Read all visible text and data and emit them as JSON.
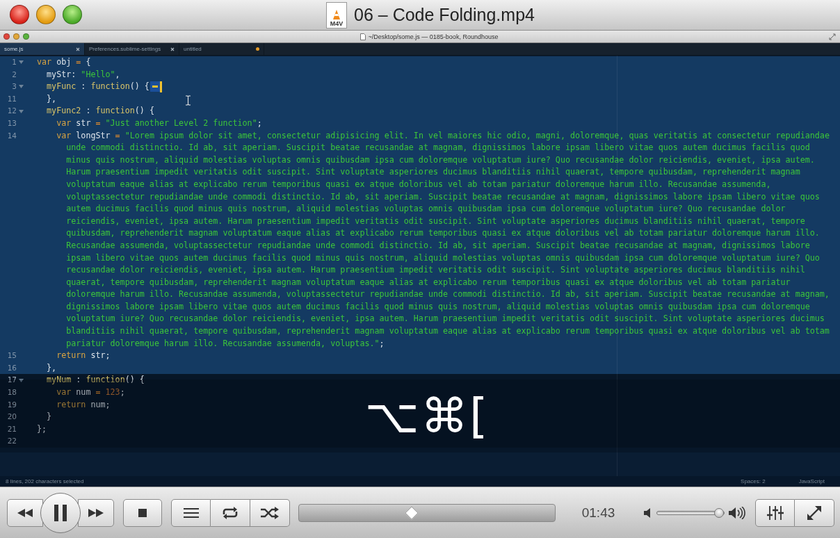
{
  "player": {
    "title": "06 – Code Folding.mp4",
    "file_badge": "M4V"
  },
  "editor": {
    "title": "~/Desktop/some.js — 0185-book, Roundhouse",
    "tabs": [
      {
        "label": "some.js",
        "selected": true,
        "modified": false
      },
      {
        "label": "Preferences.sublime-settings",
        "selected": false,
        "modified": false
      },
      {
        "label": "untitled",
        "selected": false,
        "modified": true
      }
    ],
    "lines": [
      {
        "number": "1",
        "foldable": true,
        "folded": false,
        "selected": true,
        "segments": [
          {
            "kind": "kw",
            "text": "var"
          },
          {
            "kind": "id",
            "text": " obj "
          },
          {
            "kind": "op",
            "text": "="
          },
          {
            "kind": "p",
            "text": " {"
          }
        ]
      },
      {
        "number": "2",
        "foldable": false,
        "folded": false,
        "selected": true,
        "segments": [
          {
            "kind": "id",
            "text": "  myStr: "
          },
          {
            "kind": "str",
            "text": "\"Hello\""
          },
          {
            "kind": "p",
            "text": ","
          }
        ]
      },
      {
        "number": "3",
        "foldable": true,
        "folded": true,
        "selected": true,
        "segments": [
          {
            "kind": "fn",
            "text": "  myFunc"
          },
          {
            "kind": "p",
            "text": " : "
          },
          {
            "kind": "fn",
            "text": "function"
          },
          {
            "kind": "p",
            "text": "() {"
          }
        ]
      },
      {
        "number": "11",
        "foldable": false,
        "folded": false,
        "selected": true,
        "segments": [
          {
            "kind": "p",
            "text": "  },"
          }
        ]
      },
      {
        "number": "12",
        "foldable": true,
        "folded": false,
        "selected": true,
        "segments": [
          {
            "kind": "fn",
            "text": "  myFunc2"
          },
          {
            "kind": "p",
            "text": " : "
          },
          {
            "kind": "fn",
            "text": "function"
          },
          {
            "kind": "p",
            "text": "() {"
          }
        ]
      },
      {
        "number": "13",
        "foldable": false,
        "folded": false,
        "selected": true,
        "segments": [
          {
            "kind": "kw",
            "text": "    var"
          },
          {
            "kind": "id",
            "text": " str "
          },
          {
            "kind": "op",
            "text": "="
          },
          {
            "kind": "str",
            "text": " \"Just another Level 2 function\""
          },
          {
            "kind": "p",
            "text": ";"
          }
        ]
      },
      {
        "number": "14",
        "foldable": false,
        "folded": false,
        "selected": true,
        "segments": [
          {
            "kind": "kw",
            "text": "    var"
          },
          {
            "kind": "id",
            "text": " longStr "
          },
          {
            "kind": "op",
            "text": "="
          },
          {
            "kind": "str",
            "text": " \"Lorem ipsum dolor sit amet, consectetur adipisicing elit. In vel maiores hic odio, magni, doloremque, quas veritatis at consectetur repudiandae"
          }
        ],
        "continuation": [
          [
            {
              "kind": "str",
              "text": "unde commodi distinctio. Id ab, sit aperiam. Suscipit beatae recusandae at magnam, dignissimos labore ipsam libero vitae quos autem ducimus facilis quod"
            }
          ],
          [
            {
              "kind": "str",
              "text": "minus quis nostrum, aliquid molestias voluptas omnis quibusdam ipsa cum doloremque voluptatum iure? Quo recusandae dolor reiciendis, eveniet, ipsa autem."
            }
          ],
          [
            {
              "kind": "str",
              "text": "Harum praesentium impedit veritatis odit suscipit. Sint voluptate asperiores ducimus blanditiis nihil quaerat, tempore quibusdam, reprehenderit magnam"
            }
          ],
          [
            {
              "kind": "str",
              "text": "voluptatum eaque alias at explicabo rerum temporibus quasi ex atque doloribus vel ab totam pariatur doloremque harum illo. Recusandae assumenda,"
            }
          ],
          [
            {
              "kind": "str",
              "text": "voluptassectetur repudiandae unde commodi distinctio. Id ab, sit aperiam. Suscipit beatae recusandae at magnam, dignissimos labore ipsam libero vitae quos"
            }
          ],
          [
            {
              "kind": "str",
              "text": "autem ducimus facilis quod minus quis nostrum, aliquid molestias voluptas omnis quibusdam ipsa cum doloremque voluptatum iure? Quo recusandae dolor"
            }
          ],
          [
            {
              "kind": "str",
              "text": "reiciendis, eveniet, ipsa autem. Harum praesentium impedit veritatis odit suscipit. Sint voluptate asperiores ducimus blanditiis nihil quaerat, tempore"
            }
          ],
          [
            {
              "kind": "str",
              "text": "quibusdam, reprehenderit magnam voluptatum eaque alias at explicabo rerum temporibus quasi ex atque doloribus vel ab totam pariatur doloremque harum illo."
            }
          ],
          [
            {
              "kind": "str",
              "text": "Recusandae assumenda, voluptassectetur repudiandae unde commodi distinctio. Id ab, sit aperiam. Suscipit beatae recusandae at magnam, dignissimos labore"
            }
          ],
          [
            {
              "kind": "str",
              "text": "ipsam libero vitae quos autem ducimus facilis quod minus quis nostrum, aliquid molestias voluptas omnis quibusdam ipsa cum doloremque voluptatum iure? Quo"
            }
          ],
          [
            {
              "kind": "str",
              "text": "recusandae dolor reiciendis, eveniet, ipsa autem. Harum praesentium impedit veritatis odit suscipit. Sint voluptate asperiores ducimus blanditiis nihil"
            }
          ],
          [
            {
              "kind": "str",
              "text": "quaerat, tempore quibusdam, reprehenderit magnam voluptatum eaque alias at explicabo rerum temporibus quasi ex atque doloribus vel ab totam pariatur"
            }
          ],
          [
            {
              "kind": "str",
              "text": "doloremque harum illo. Recusandae assumenda, voluptassectetur repudiandae unde commodi distinctio. Id ab, sit aperiam. Suscipit beatae recusandae at magnam,"
            }
          ],
          [
            {
              "kind": "str",
              "text": "dignissimos labore ipsam libero vitae quos autem ducimus facilis quod minus quis nostrum, aliquid molestias voluptas omnis quibusdam ipsa cum doloremque"
            }
          ],
          [
            {
              "kind": "str",
              "text": "voluptatum iure? Quo recusandae dolor reiciendis, eveniet, ipsa autem. Harum praesentium impedit veritatis odit suscipit. Sint voluptate asperiores ducimus"
            }
          ],
          [
            {
              "kind": "str",
              "text": "blanditiis nihil quaerat, tempore quibusdam, reprehenderit magnam voluptatum eaque alias at explicabo rerum temporibus quasi ex atque doloribus vel ab totam"
            }
          ],
          [
            {
              "kind": "str",
              "text": "pariatur doloremque harum illo. Recusandae assumenda, voluptas.\""
            },
            {
              "kind": "p",
              "text": ";"
            }
          ]
        ]
      },
      {
        "number": "15",
        "foldable": false,
        "folded": false,
        "selected": true,
        "segments": [
          {
            "kind": "kw",
            "text": "    return"
          },
          {
            "kind": "id",
            "text": " str;"
          }
        ]
      },
      {
        "number": "16",
        "foldable": false,
        "folded": false,
        "selected": true,
        "segments": [
          {
            "kind": "p",
            "text": "  },"
          }
        ]
      },
      {
        "number": "17",
        "foldable": true,
        "folded": false,
        "selected": false,
        "segments": [
          {
            "kind": "fn",
            "text": "  myNum"
          },
          {
            "kind": "p",
            "text": " : "
          },
          {
            "kind": "fn",
            "text": "function"
          },
          {
            "kind": "p",
            "text": "() {"
          }
        ]
      },
      {
        "number": "18",
        "foldable": false,
        "folded": false,
        "selected": false,
        "segments": [
          {
            "kind": "kw",
            "text": "    var"
          },
          {
            "kind": "id",
            "text": " num "
          },
          {
            "kind": "op",
            "text": "="
          },
          {
            "kind": "num",
            "text": " 123"
          },
          {
            "kind": "p",
            "text": ";"
          }
        ]
      },
      {
        "number": "19",
        "foldable": false,
        "folded": false,
        "selected": false,
        "segments": [
          {
            "kind": "kw",
            "text": "    return"
          },
          {
            "kind": "id",
            "text": " num;"
          }
        ]
      },
      {
        "number": "20",
        "foldable": false,
        "folded": false,
        "selected": false,
        "segments": [
          {
            "kind": "p",
            "text": "  }"
          }
        ]
      },
      {
        "number": "21",
        "foldable": false,
        "folded": false,
        "selected": false,
        "segments": [
          {
            "kind": "p",
            "text": "};"
          }
        ]
      },
      {
        "number": "22",
        "foldable": false,
        "folded": false,
        "selected": false
      }
    ],
    "keystroke_overlay": "⌥⌘[",
    "status_bar": {
      "selection": "8 lines, 202 characters selected",
      "indentation": "Spaces: 2",
      "syntax": "JavaScript"
    }
  },
  "controls": {
    "playing": true,
    "progress": {
      "level": 0.44
    },
    "time": "01:43",
    "volume": {
      "level": 0.93
    }
  }
}
